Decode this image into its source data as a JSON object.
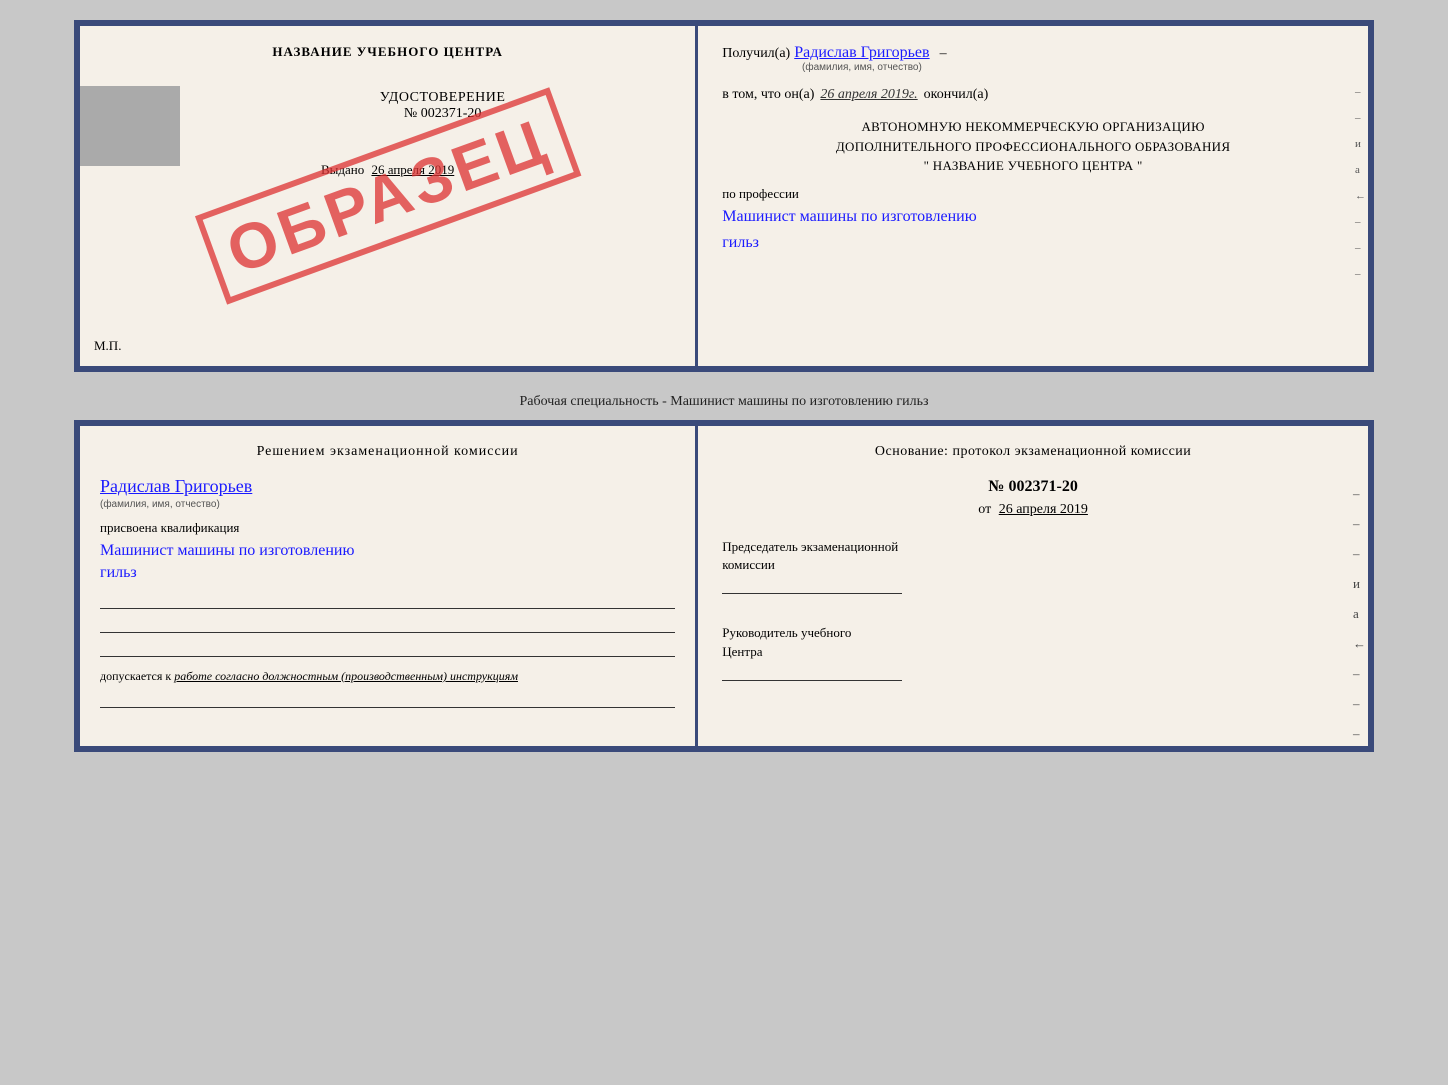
{
  "top_doc": {
    "left": {
      "school_name": "НАЗВАНИЕ УЧЕБНОГО ЦЕНТРА",
      "udostoverenie_label": "УДОСТОВЕРЕНИЕ",
      "number": "№ 002371-20",
      "vydano_label": "Выдано",
      "vydano_date": "26 апреля 2019",
      "mp_label": "М.П.",
      "obrazec": "ОБРАЗЕЦ"
    },
    "right": {
      "poluchil_label": "Получил(а)",
      "fio": "Радислав Григорьев",
      "fio_sub": "(фамилия, имя, отчество)",
      "vtom_label": "в том, что он(а)",
      "vtom_date": "26 апреля 2019г.",
      "okonchil_label": "окончил(а)",
      "org_line1": "АВТОНОМНУЮ НЕКОММЕРЧЕСКУЮ ОРГАНИЗАЦИЮ",
      "org_line2": "ДОПОЛНИТЕЛЬНОГО ПРОФЕССИОНАЛЬНОГО ОБРАЗОВАНИЯ",
      "org_line3": "\"   НАЗВАНИЕ УЧЕБНОГО ЦЕНТРА   \"",
      "po_professii": "по профессии",
      "profession_line1": "Машинист машины по изготовлению",
      "profession_line2": "гильз",
      "dash1": "–",
      "dash2": "–",
      "dash3": "–",
      "side_i": "и",
      "side_a": "а",
      "side_left": "←"
    }
  },
  "middle_caption": "Рабочая специальность - Машинист машины по изготовлению гильз",
  "bottom_doc": {
    "left": {
      "decision_title": "Решением  экзаменационной  комиссии",
      "fio": "Радислав Григорьев",
      "fio_sub": "(фамилия, имя, отчество)",
      "prisvoena_label": "присвоена квалификация",
      "profession_line1": "Машинист машины по изготовлению",
      "profession_line2": "гильз",
      "dopuskaetsya_label": "допускается к",
      "dopuskaetsya_text": "работе согласно должностным (производственным) инструкциям"
    },
    "right": {
      "osnovanie_title": "Основание: протокол экзаменационной  комиссии",
      "number": "№  002371-20",
      "ot_label": "от",
      "ot_date": "26 апреля 2019",
      "predsedatel_label": "Председатель экзаменационной",
      "komissii_label": "комиссии",
      "rukovoditel_line1": "Руководитель учебного",
      "rukovoditel_line2": "Центра",
      "dash1": "–",
      "dash2": "–",
      "dash3": "–",
      "dash4": "–",
      "dash5": "–",
      "side_i": "и",
      "side_a": "а",
      "side_left": "←"
    }
  }
}
